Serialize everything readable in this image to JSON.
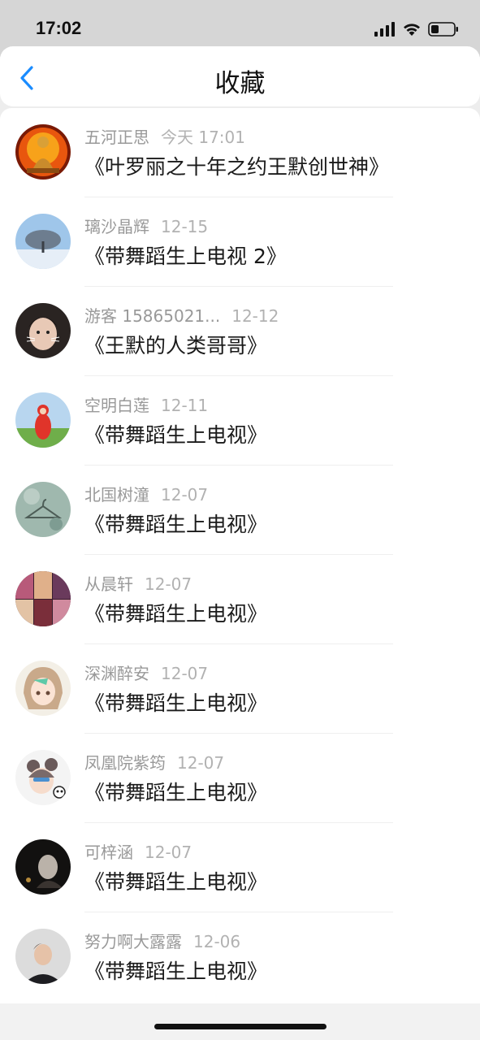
{
  "status_bar": {
    "time": "17:02",
    "icons": [
      "signal-icon",
      "wifi-icon",
      "battery-icon"
    ]
  },
  "header": {
    "title": "收藏",
    "back_icon": "chevron-left-icon",
    "accent_color": "#1a8cff"
  },
  "favorites": [
    {
      "user": "五河正思",
      "time": "今天 17:01",
      "title": "《叶罗丽之十年之约王默创世神》",
      "avatar": "buddha-avatar"
    },
    {
      "user": "璃沙晶辉",
      "time": "12-15",
      "title": "《带舞蹈生上电视 2》",
      "avatar": "snow-tree-avatar"
    },
    {
      "user": "游客 15865021...",
      "time": "12-12",
      "title": "《王默的人类哥哥》",
      "avatar": "cat-filter-avatar"
    },
    {
      "user": "空明白莲",
      "time": "12-11",
      "title": "《带舞蹈生上电视》",
      "avatar": "teletubby-avatar"
    },
    {
      "user": "北国树潼",
      "time": "12-07",
      "title": "《带舞蹈生上电视》",
      "avatar": "hanger-avatar"
    },
    {
      "user": "从晨轩",
      "time": "12-07",
      "title": "《带舞蹈生上电视》",
      "avatar": "collage-avatar"
    },
    {
      "user": "深渊醉安",
      "time": "12-07",
      "title": "《带舞蹈生上电视》",
      "avatar": "anime-girl-avatar"
    },
    {
      "user": "凤凰院紫筠",
      "time": "12-07",
      "title": "《带舞蹈生上电视》",
      "avatar": "beijing-panda-avatar"
    },
    {
      "user": "可梓涵",
      "time": "12-07",
      "title": "《带舞蹈生上电视》",
      "avatar": "dark-photo-avatar"
    },
    {
      "user": "努力啊大露露",
      "time": "12-06",
      "title": "《带舞蹈生上电视》",
      "avatar": "man-portrait-avatar"
    }
  ]
}
